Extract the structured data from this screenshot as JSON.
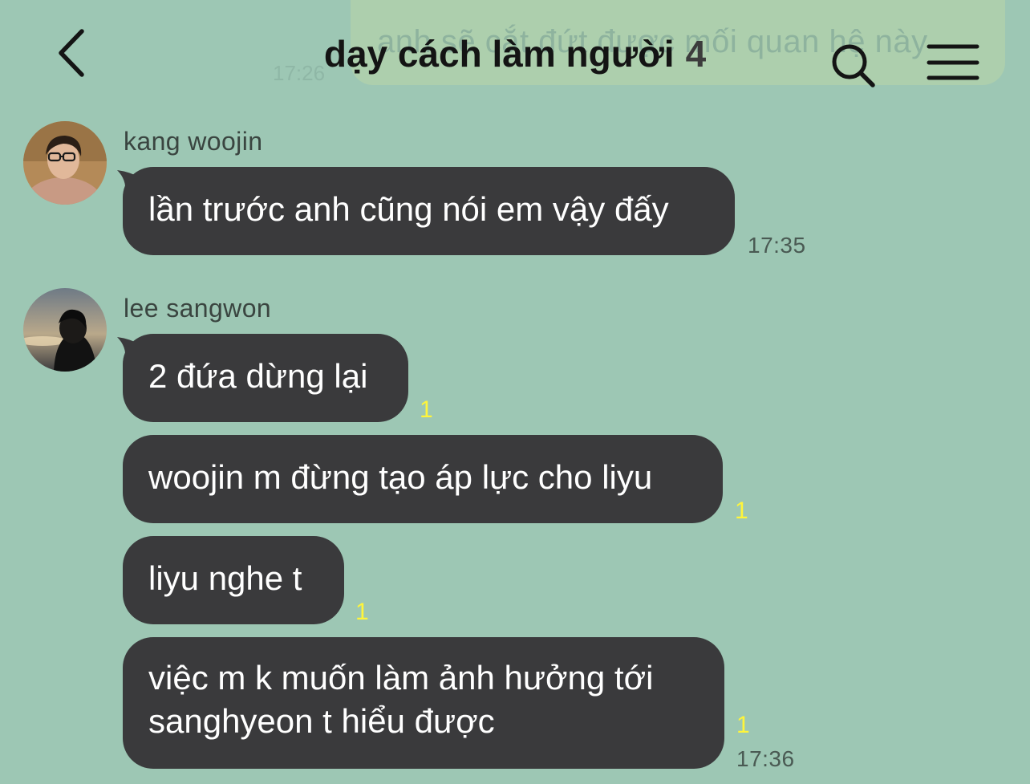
{
  "chat": {
    "title": "dạy cách làm người",
    "member_count": "4",
    "background_color": "#9dc7b4",
    "bubble_color": "#3a3a3c",
    "unread_color": "#fff53a"
  },
  "header": {
    "back_icon": "chevron-left-icon",
    "search_icon": "search-icon",
    "menu_icon": "menu-icon"
  },
  "ghost": {
    "text": "anh sẽ cắt đứt được mối quan hệ này",
    "time": "17:26"
  },
  "messages": [
    {
      "sender": "kang woojin",
      "text": "lần trước anh cũng nói em vậy đấy",
      "time": "17:35"
    },
    {
      "sender": "lee sangwon",
      "text": "2 đứa dừng lại",
      "unread": "1"
    },
    {
      "text": "woojin m đừng tạo áp lực cho liyu",
      "unread": "1"
    },
    {
      "text": "liyu nghe t",
      "unread": "1"
    },
    {
      "text_line1": "việc m k muốn làm ảnh hưởng tới",
      "text_line2": "sanghyeon t hiểu được",
      "unread": "1",
      "time": "17:36"
    }
  ]
}
